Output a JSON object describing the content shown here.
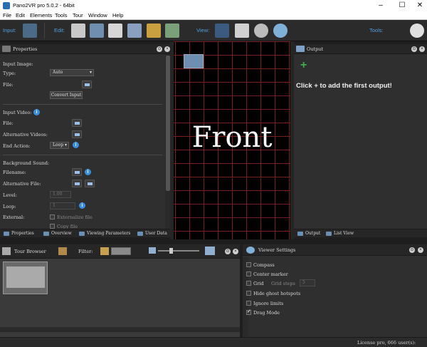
{
  "window": {
    "title": "Pano2VR pro 5.0.2 - 64bit",
    "minimize": "–",
    "maximize": "☐",
    "close": "✕"
  },
  "menu": [
    "File",
    "Edit",
    "Elements",
    "Tools",
    "Tour",
    "Window",
    "Help"
  ],
  "toolbar": {
    "input_label": "Input:",
    "edit_label": "Edit:",
    "view_label": "View:",
    "tools_label": "Tools:"
  },
  "properties": {
    "title": "Properties",
    "input_image": "Input Image:",
    "type_label": "Type:",
    "type_value": "Auto",
    "file_label": "File:",
    "convert_button": "Convert Input",
    "input_video": "Input Video:",
    "video_file_label": "File:",
    "alt_videos_label": "Alternative Videos:",
    "end_action_label": "End Action:",
    "end_action_value": "Loop",
    "background_sound": "Background Sound:",
    "filename_label": "Filename:",
    "alt_file_label": "Alternative File:",
    "level_label": "Level:",
    "level_value": "1.00",
    "loop_label": "Loop:",
    "loop_value": "1",
    "external_label": "External:",
    "externalize": "Externalize file",
    "copy_file": "Copy file"
  },
  "left_tabs": [
    "Properties",
    "Overview",
    "Viewing Parameters",
    "User Data"
  ],
  "viewer": {
    "face_label": "Front"
  },
  "output": {
    "title": "Output",
    "hint": "Click + to add the first output!",
    "add": "+"
  },
  "right_tabs": [
    "Output",
    "List View"
  ],
  "tour_browser": {
    "title": "Tour Browser",
    "filter_label": "Filter:"
  },
  "viewer_settings": {
    "title": "Viewer Settings",
    "items": [
      {
        "label": "Compass",
        "checked": false
      },
      {
        "label": "Center marker",
        "checked": false
      },
      {
        "label": "Grid",
        "checked": false
      },
      {
        "label": "Hide ghost hotspots",
        "checked": false
      },
      {
        "label": "Ignore limits",
        "checked": false
      },
      {
        "label": "Drag Mode",
        "checked": true
      }
    ],
    "grid_steps_label": "Grid steps",
    "grid_steps_value": "5"
  },
  "status": {
    "license": "License pro, 666 user(s):"
  },
  "colors": {
    "accent": "#4ea0e0",
    "grid": "#7a1f1f",
    "panel": "#2f2f2f",
    "add_green": "#3cb043"
  },
  "icons": [
    "app-icon",
    "add-panorama-icon",
    "tour-browser-icon",
    "viewing-parameters-icon",
    "patch-icon",
    "hotspot-icon",
    "user-data-icon",
    "tools-icon",
    "binoculars-icon",
    "clipboard-icon",
    "stopwatch-icon",
    "eye-icon",
    "film-reel-icon",
    "folder-icon",
    "info-icon",
    "add-icon",
    "thumbnail-icon",
    "slider-icon"
  ]
}
